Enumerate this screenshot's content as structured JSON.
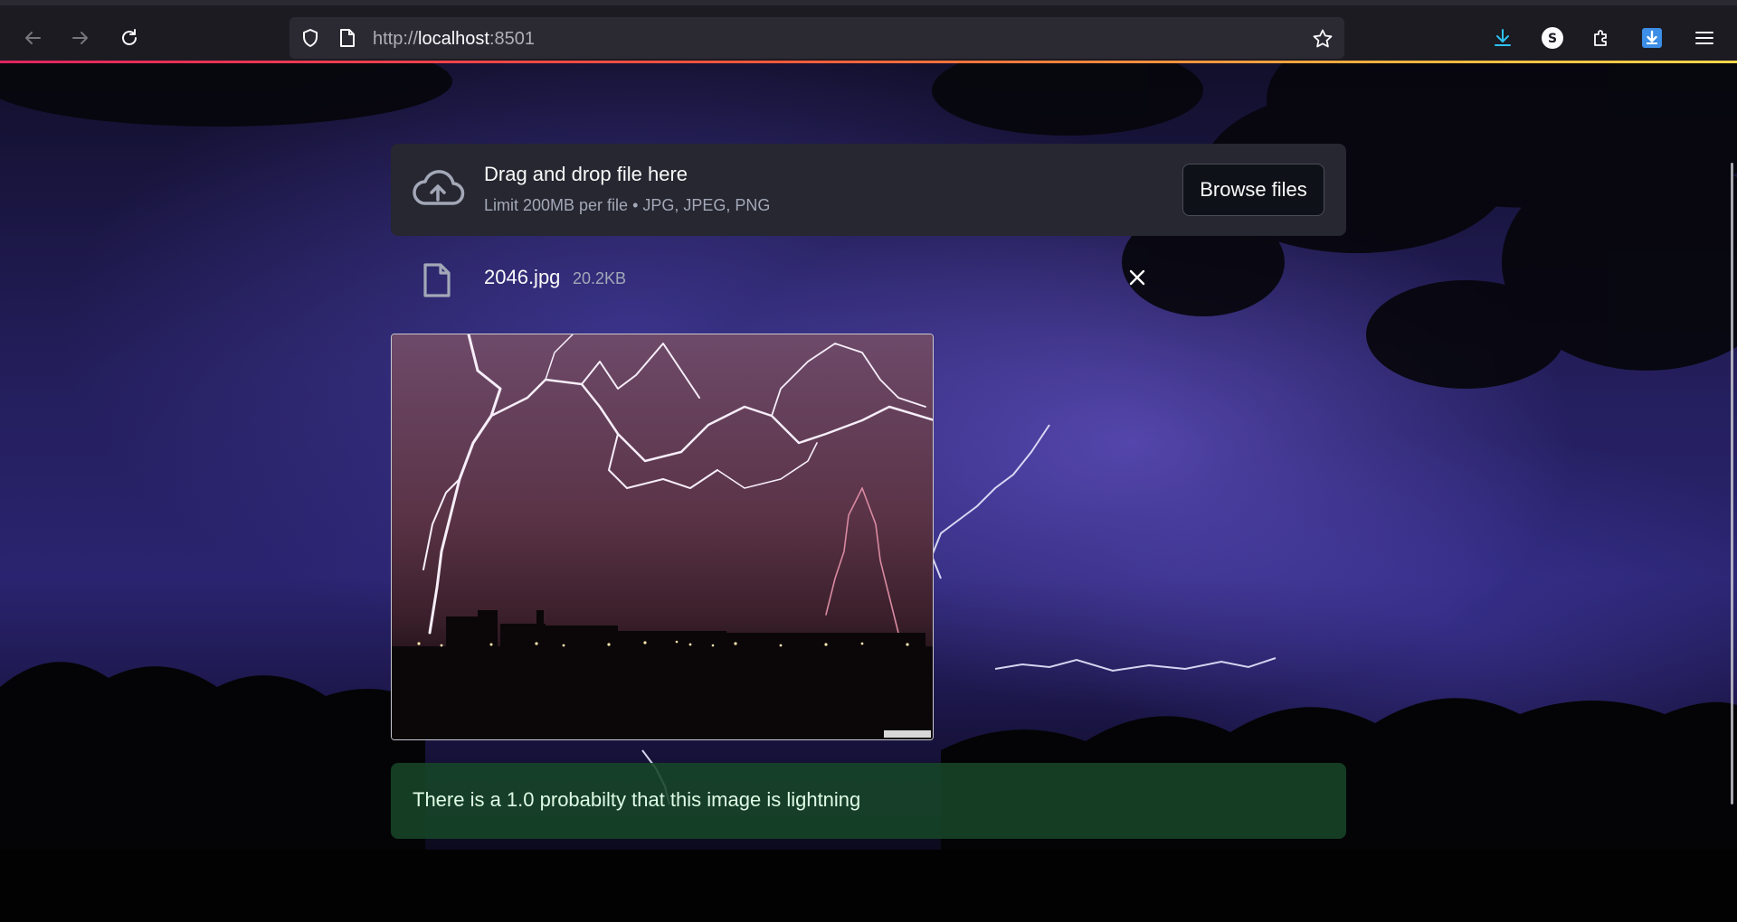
{
  "browser": {
    "url_scheme": "http://",
    "url_host": "localhost",
    "url_port": ":8501"
  },
  "uploader": {
    "title": "Drag and drop file here",
    "subtitle": "Limit 200MB per file • JPG, JPEG, PNG",
    "browse_label": "Browse files"
  },
  "file": {
    "name": "2046.jpg",
    "size": "20.2KB"
  },
  "result": {
    "message": "There is a 1.0 probabilty that this image is lightning"
  },
  "colors": {
    "browser_bg": "#1c1b22",
    "dropzone_bg": "#262730",
    "success_bg": "#174628"
  }
}
